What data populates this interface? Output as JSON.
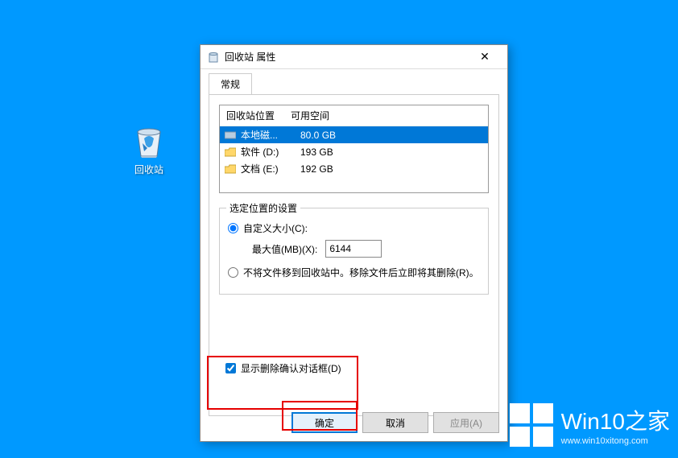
{
  "desktop": {
    "recycle_bin_label": "回收站"
  },
  "dialog": {
    "title": "回收站 属性",
    "close": "✕",
    "tabs": {
      "general": "常规"
    },
    "list": {
      "header_location": "回收站位置",
      "header_space": "可用空间",
      "rows": [
        {
          "name": "本地磁...",
          "space": "80.0 GB",
          "selected": true
        },
        {
          "name": "软件 (D:)",
          "space": "193 GB",
          "selected": false
        },
        {
          "name": "文档 (E:)",
          "space": "192 GB",
          "selected": false
        }
      ]
    },
    "settings": {
      "legend": "选定位置的设置",
      "custom_size_label": "自定义大小(C):",
      "max_size_label": "最大值(MB)(X):",
      "max_size_value": "6144",
      "direct_delete_label": "不将文件移到回收站中。移除文件后立即将其删除(R)。"
    },
    "confirm_delete_label": "显示删除确认对话框(D)",
    "buttons": {
      "ok": "确定",
      "cancel": "取消",
      "apply": "应用(A)"
    }
  },
  "watermark": {
    "title": "Win10之家",
    "url": "www.win10xitong.com"
  }
}
